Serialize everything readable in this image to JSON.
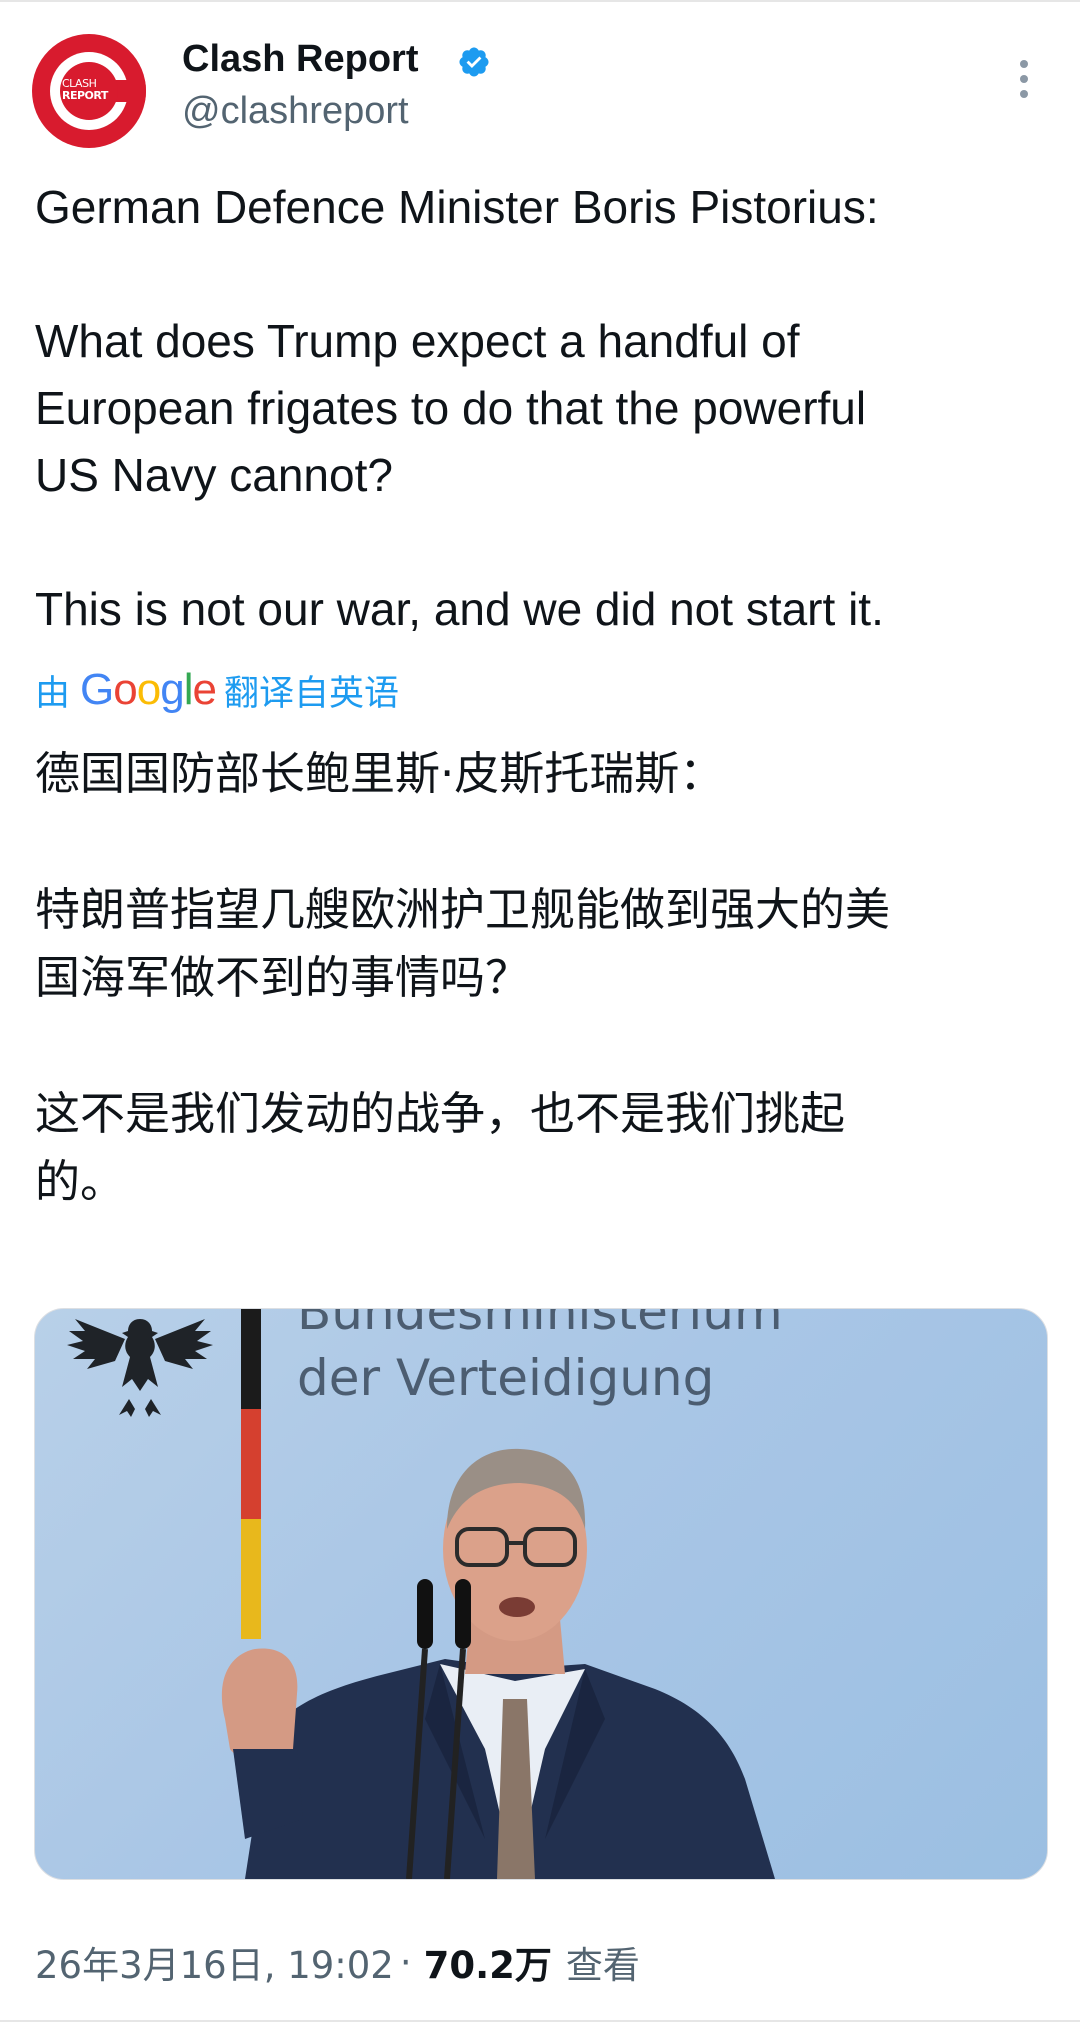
{
  "author": {
    "display_name": "Clash Report",
    "handle": "@clashreport",
    "avatar_text_line1": "CLASH",
    "avatar_text_line2": "REPORT",
    "verified_icon": "verified-badge-icon",
    "accent_color": "#1d9bf0",
    "avatar_color": "#d81b2e"
  },
  "tweet": {
    "lines": [
      "German Defence Minister Boris Pistorius:",
      "What does Trump expect a handful of",
      "European frigates to do that the powerful",
      "US Navy cannot?",
      "This is not our war, and we did not start it."
    ]
  },
  "translation": {
    "prefix": "由",
    "provider": "Google",
    "suffix": "翻译自英语",
    "lines": [
      "德国国防部长鲍里斯·皮斯托瑞斯：",
      "特朗普指望几艘欧洲护卫舰能做到强大的美",
      "国海军做不到的事情吗？",
      "这不是我们发动的战争，也不是我们挑起",
      "的。"
    ]
  },
  "media": {
    "sign_line1": "Bundesministerium",
    "sign_line2": "der Verteidigung"
  },
  "footer": {
    "datetime": "26年3月16日, 19:02",
    "separator": "·",
    "views": "70.2万",
    "views_label": "查看"
  }
}
